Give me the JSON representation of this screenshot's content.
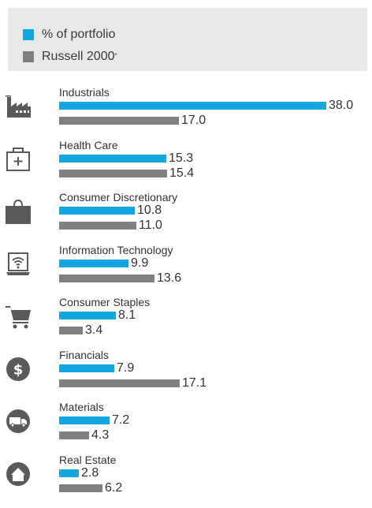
{
  "colors": {
    "portfolio": "#12a7e0",
    "russell": "#808080",
    "icon": "#5a5a5a",
    "legend_bg": "#e9e9ea"
  },
  "legend": {
    "portfolio_label": "% of portfolio",
    "russell_label": "Russell 2000",
    "russell_mark": "*"
  },
  "chart_data": {
    "type": "bar",
    "orientation": "horizontal",
    "categories": [
      "Industrials",
      "Health Care",
      "Consumer Discretionary",
      "Information Technology",
      "Consumer Staples",
      "Financials",
      "Materials",
      "Real Estate"
    ],
    "icons": [
      "factory-icon",
      "first-aid-kit-icon",
      "shopping-bag-icon",
      "laptop-wifi-icon",
      "shopping-cart-icon",
      "dollar-coin-icon",
      "delivery-truck-icon",
      "house-icon"
    ],
    "series": [
      {
        "name": "% of portfolio",
        "values": [
          38.0,
          15.3,
          10.8,
          9.9,
          8.1,
          7.9,
          7.2,
          2.8
        ]
      },
      {
        "name": "Russell 2000",
        "values": [
          17.0,
          15.4,
          11.0,
          13.6,
          3.4,
          17.1,
          4.3,
          6.2
        ]
      }
    ],
    "value_labels": {
      "portfolio": [
        "38.0",
        "15.3",
        "10.8",
        "9.9",
        "8.1",
        "7.9",
        "7.2",
        "2.8"
      ],
      "russell": [
        "17.0",
        "15.4",
        "11.0",
        "13.6",
        "3.4",
        "17.1",
        "4.3",
        "6.2"
      ]
    },
    "xlim": [
      0,
      38
    ],
    "legend_position": "top",
    "grid": false
  }
}
